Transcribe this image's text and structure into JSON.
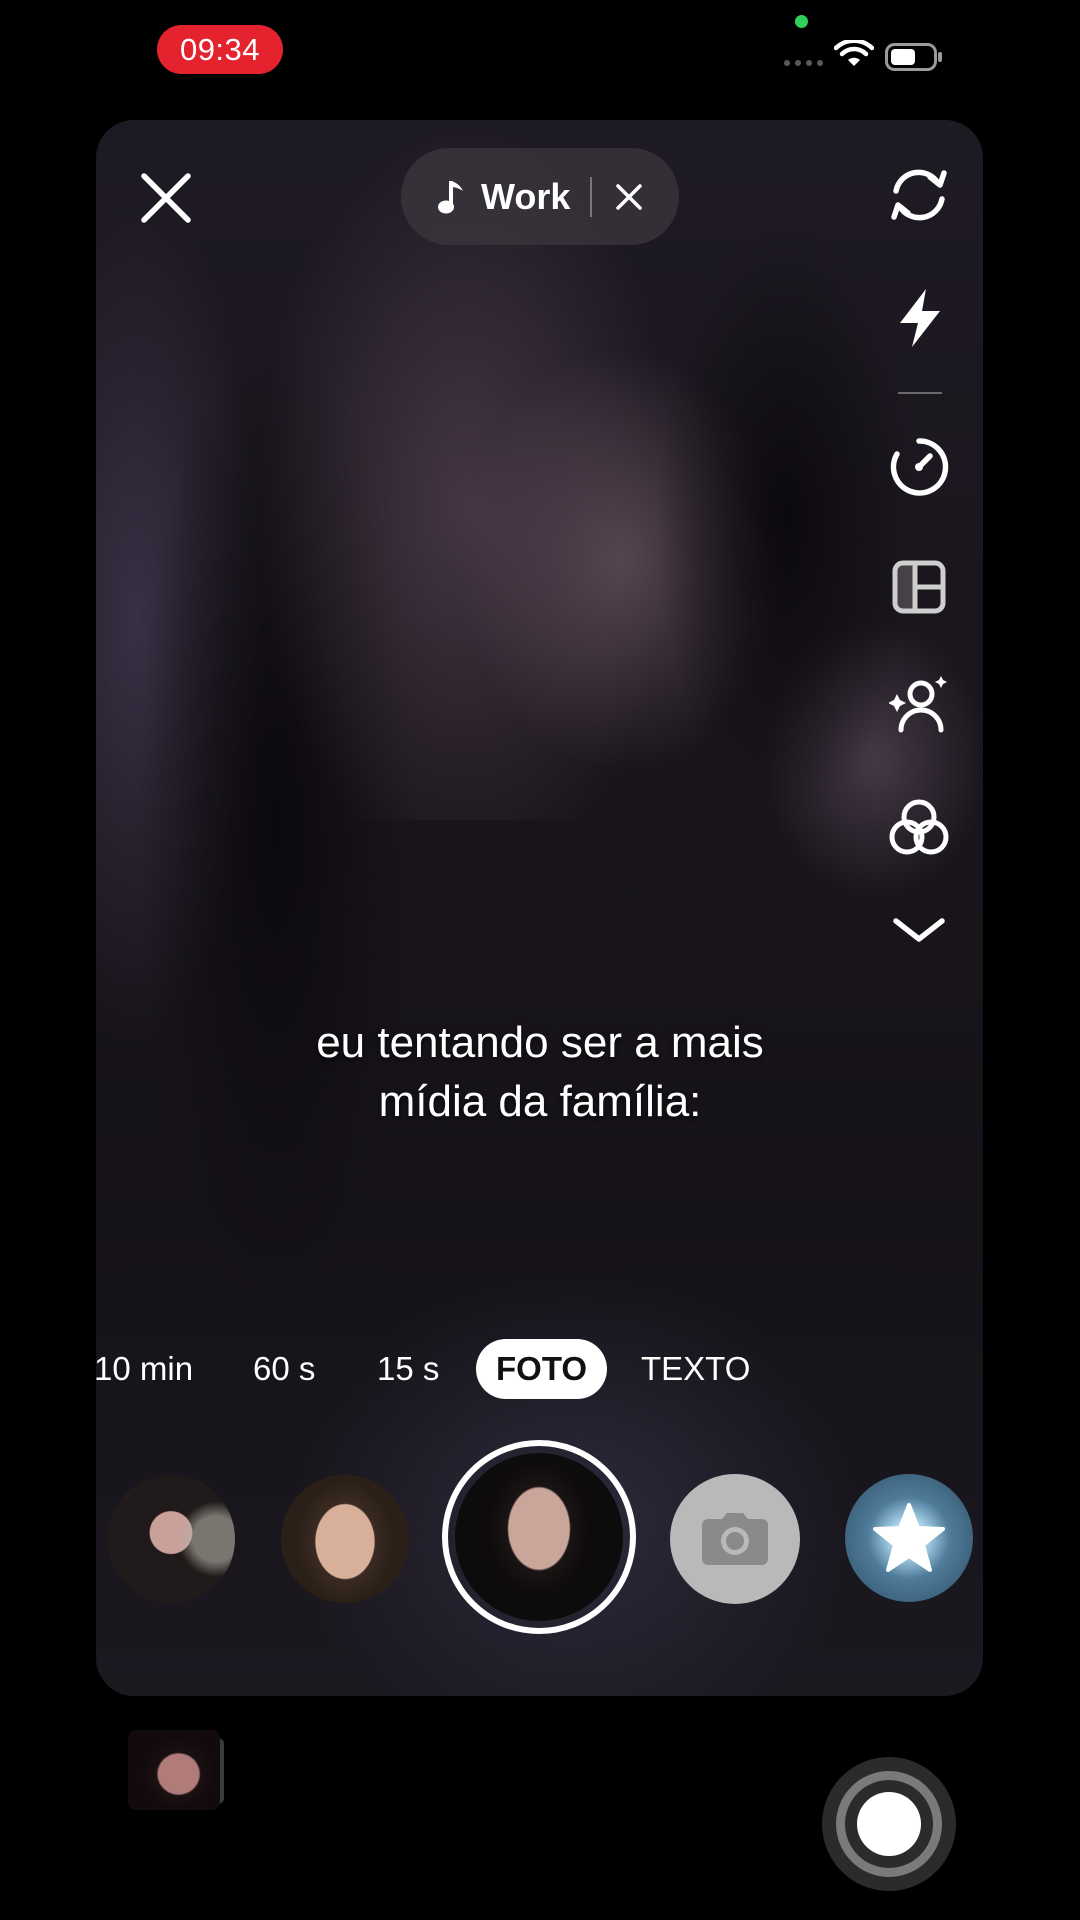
{
  "status_bar": {
    "time": "09:34",
    "wifi_icon": "wifi-icon",
    "battery_icon": "battery-icon",
    "signal_icon": "cellular-signal-icon"
  },
  "top_bar": {
    "close_icon": "close-icon",
    "music": {
      "icon": "music-note-icon",
      "title": "Work",
      "remove_icon": "close-icon"
    }
  },
  "side_tools": [
    {
      "name": "flip-camera",
      "icon": "flip-camera-icon"
    },
    {
      "name": "flash",
      "icon": "flash-icon"
    },
    {
      "name": "timer",
      "icon": "timer-icon"
    },
    {
      "name": "layout",
      "icon": "layout-grid-icon"
    },
    {
      "name": "beauty",
      "icon": "beauty-person-sparkle-icon"
    },
    {
      "name": "filters",
      "icon": "filters-circles-icon"
    },
    {
      "name": "more",
      "icon": "chevron-down-icon"
    }
  ],
  "caption": {
    "line1": "eu tentando ser a mais",
    "line2": "mídia da família:"
  },
  "modes": [
    {
      "label": "10 min",
      "active": false
    },
    {
      "label": "60 s",
      "active": false
    },
    {
      "label": "15 s",
      "active": false
    },
    {
      "label": "FOTO",
      "active": true
    },
    {
      "label": "TEXTO",
      "active": false
    }
  ],
  "effects_carousel": [
    {
      "name": "effect-thumbnail-1",
      "icon": "avatar"
    },
    {
      "name": "effect-thumbnail-2",
      "icon": "avatar"
    },
    {
      "name": "effect-thumbnail-selected",
      "icon": "avatar"
    },
    {
      "name": "camera-effect",
      "icon": "camera-icon"
    },
    {
      "name": "star-effect",
      "icon": "star-icon"
    }
  ],
  "bottom_bar": {
    "gallery_icon": "gallery-thumbnail",
    "shutter_icon": "shutter-button"
  },
  "colors": {
    "time_pill": "#e5232f",
    "green_indicator": "#30d158",
    "active_mode_bg": "#ffffff"
  }
}
